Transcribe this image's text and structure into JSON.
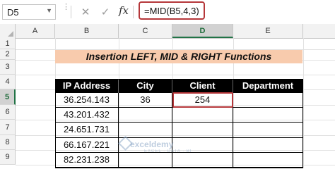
{
  "formula_bar": {
    "name_box": "D5",
    "cancel_icon": "✕",
    "enter_icon": "✓",
    "fx": "fx",
    "formula": "=MID(B5,4,3)"
  },
  "columns": [
    "A",
    "B",
    "C",
    "D",
    "E"
  ],
  "rows": [
    "1",
    "2",
    "3",
    "4",
    "5",
    "6",
    "7",
    "8",
    "9"
  ],
  "selected_cell": {
    "column": "D",
    "row": "5"
  },
  "sheet": {
    "title": "Insertion LEFT, MID & RIGHT Functions",
    "headers": [
      "IP Address",
      "City",
      "Client",
      "Department"
    ],
    "rows": [
      {
        "ip": "36.254.143",
        "city": "36",
        "client": "254",
        "department": ""
      },
      {
        "ip": "43.201.432",
        "city": "",
        "client": "",
        "department": ""
      },
      {
        "ip": "24.651.731",
        "city": "",
        "client": "",
        "department": ""
      },
      {
        "ip": "66.167.221",
        "city": "",
        "client": "",
        "department": ""
      },
      {
        "ip": "82.231.238",
        "city": "",
        "client": "",
        "department": ""
      }
    ]
  },
  "watermark": {
    "name": "exceldemy",
    "tagline": "EXCEL · DATA · BI"
  },
  "colors": {
    "accent_red": "#b5373a",
    "title_fill": "#f8cbad",
    "header_fill": "#000000",
    "excel_green": "#217346"
  }
}
